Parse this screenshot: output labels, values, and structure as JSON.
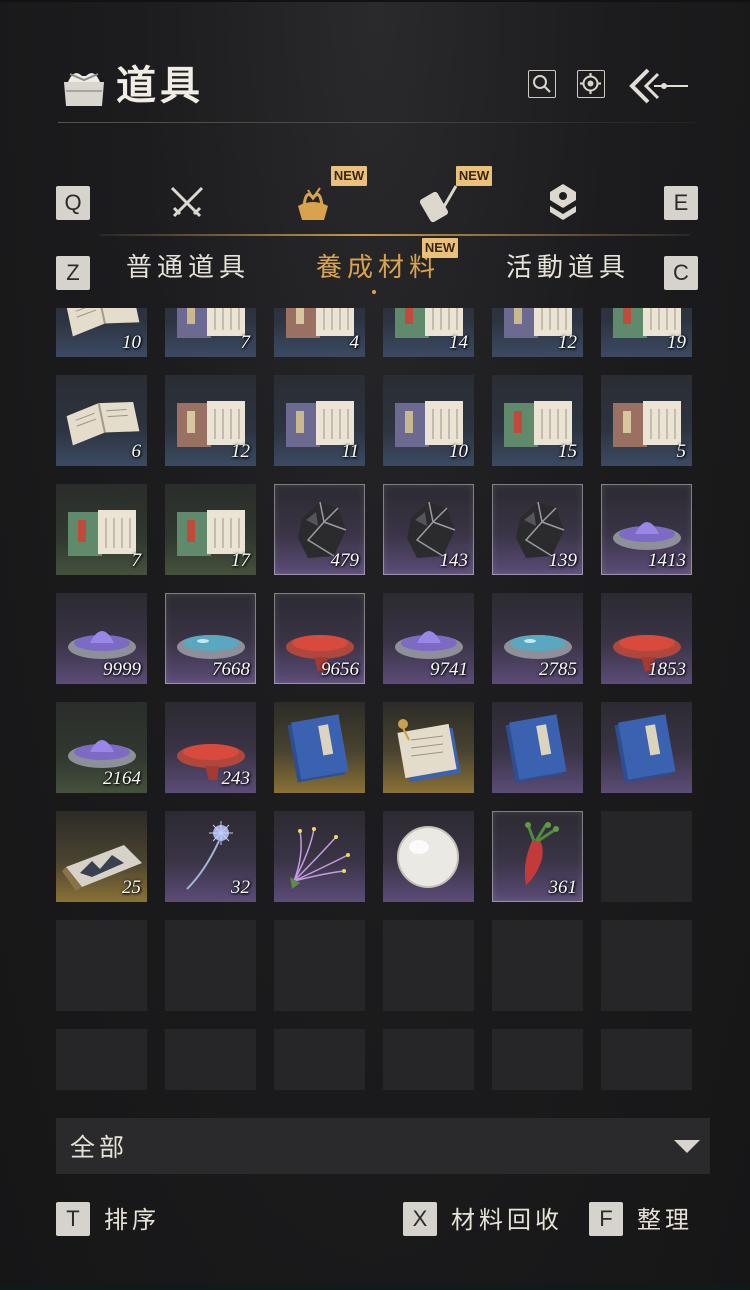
{
  "header": {
    "title": "道具"
  },
  "keys": {
    "prev_category": "Q",
    "next_category": "E",
    "prev_subtab": "Z",
    "next_subtab": "C",
    "sort": "T",
    "recycle": "X",
    "organize": "F"
  },
  "category_tabs": [
    {
      "icon": "crossed-swords-icon",
      "new": false,
      "active": false
    },
    {
      "icon": "cloth-bundle-icon",
      "new": true,
      "new_label": "NEW",
      "active": true
    },
    {
      "icon": "scroll-brush-icon",
      "new": true,
      "new_label": "NEW",
      "active": false
    },
    {
      "icon": "stacked-gem-icon",
      "new": false,
      "active": false
    }
  ],
  "sub_tabs": [
    {
      "label": "普通道具",
      "active": false
    },
    {
      "label": "養成材料",
      "active": true,
      "new_label": "NEW"
    },
    {
      "label": "活動道具",
      "active": false
    }
  ],
  "inventory": {
    "rows": [
      [
        {
          "type": "book-open",
          "rarity": "blue",
          "qty": "10"
        },
        {
          "type": "book-purple",
          "rarity": "blue",
          "qty": "7"
        },
        {
          "type": "book-brown",
          "rarity": "blue",
          "qty": "4"
        },
        {
          "type": "book-green",
          "rarity": "blue",
          "qty": "14"
        },
        {
          "type": "book-purple",
          "rarity": "blue",
          "qty": "12"
        },
        {
          "type": "book-green",
          "rarity": "blue",
          "qty": "19"
        }
      ],
      [
        {
          "type": "book-open",
          "rarity": "blue",
          "qty": "6"
        },
        {
          "type": "book-brown",
          "rarity": "blue",
          "qty": "12"
        },
        {
          "type": "book-purple",
          "rarity": "blue",
          "qty": "11"
        },
        {
          "type": "book-purple",
          "rarity": "blue",
          "qty": "10"
        },
        {
          "type": "book-green",
          "rarity": "blue",
          "qty": "15"
        },
        {
          "type": "book-brown",
          "rarity": "blue",
          "qty": "5"
        }
      ],
      [
        {
          "type": "book-green",
          "rarity": "green",
          "qty": "7"
        },
        {
          "type": "book-green",
          "rarity": "green",
          "qty": "17"
        },
        {
          "type": "ore",
          "rarity": "purple",
          "qty": "479",
          "selected": true
        },
        {
          "type": "ore",
          "rarity": "purple",
          "qty": "143",
          "selected": true
        },
        {
          "type": "ore",
          "rarity": "purple",
          "qty": "139",
          "selected": true
        },
        {
          "type": "bowl-purple",
          "rarity": "purple",
          "qty": "1413",
          "selected": true
        }
      ],
      [
        {
          "type": "bowl-purple",
          "rarity": "purple",
          "qty": "9999"
        },
        {
          "type": "bowl-teal",
          "rarity": "purple",
          "qty": "7668",
          "selected": true
        },
        {
          "type": "bowl-red",
          "rarity": "purple",
          "qty": "9656",
          "selected": true
        },
        {
          "type": "bowl-purple",
          "rarity": "purple",
          "qty": "9741"
        },
        {
          "type": "bowl-teal",
          "rarity": "purple",
          "qty": "2785"
        },
        {
          "type": "bowl-red",
          "rarity": "purple",
          "qty": "1853"
        }
      ],
      [
        {
          "type": "bowl-purple",
          "rarity": "green",
          "qty": "2164"
        },
        {
          "type": "bowl-red",
          "rarity": "purple",
          "qty": "243"
        },
        {
          "type": "blue-book",
          "rarity": "gold",
          "qty": ""
        },
        {
          "type": "manual-instrument",
          "rarity": "gold",
          "qty": ""
        },
        {
          "type": "blue-book",
          "rarity": "purple",
          "qty": ""
        },
        {
          "type": "blue-book",
          "rarity": "purple",
          "qty": ""
        }
      ],
      [
        {
          "type": "landscape-scroll",
          "rarity": "gold",
          "qty": "25"
        },
        {
          "type": "dandelion",
          "rarity": "purple",
          "qty": "32"
        },
        {
          "type": "flower",
          "rarity": "purple",
          "qty": ""
        },
        {
          "type": "pearl",
          "rarity": "purple",
          "qty": ""
        },
        {
          "type": "root",
          "rarity": "purple",
          "qty": "361",
          "selected": true
        },
        {
          "type": "empty",
          "rarity": "empty",
          "qty": ""
        }
      ],
      [
        {
          "type": "empty",
          "rarity": "empty",
          "qty": ""
        },
        {
          "type": "empty",
          "rarity": "empty",
          "qty": ""
        },
        {
          "type": "empty",
          "rarity": "empty",
          "qty": ""
        },
        {
          "type": "empty",
          "rarity": "empty",
          "qty": ""
        },
        {
          "type": "empty",
          "rarity": "empty",
          "qty": ""
        },
        {
          "type": "empty",
          "rarity": "empty",
          "qty": ""
        }
      ],
      [
        {
          "type": "empty",
          "rarity": "empty",
          "qty": ""
        },
        {
          "type": "empty",
          "rarity": "empty",
          "qty": ""
        },
        {
          "type": "empty",
          "rarity": "empty",
          "qty": ""
        },
        {
          "type": "empty",
          "rarity": "empty",
          "qty": ""
        },
        {
          "type": "empty",
          "rarity": "empty",
          "qty": ""
        },
        {
          "type": "empty",
          "rarity": "empty",
          "qty": ""
        }
      ]
    ]
  },
  "filter": {
    "selected": "全部"
  },
  "actions": {
    "sort_label": "排序",
    "recycle_label": "材料回收",
    "organize_label": "整理"
  },
  "colors": {
    "accent": "#d9a24e",
    "new_badge": "#e9c17a"
  }
}
